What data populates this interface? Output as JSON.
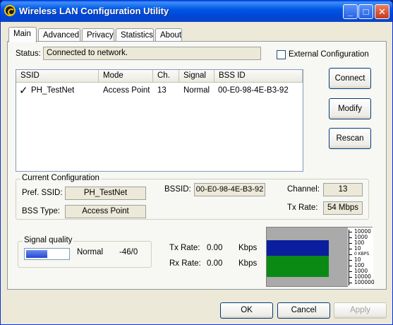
{
  "window": {
    "title": "Wireless LAN Configuration Utility",
    "min_glyph": "_",
    "max_glyph": "□",
    "close_glyph": "✕"
  },
  "tabs": [
    "Main",
    "Advanced",
    "Privacy",
    "Statistics",
    "About"
  ],
  "status": {
    "label": "Status:",
    "value": "Connected to network.",
    "external_config_label": "External Configuration",
    "external_config_checked": false
  },
  "network_list": {
    "columns": [
      "SSID",
      "Mode",
      "Ch.",
      "Signal",
      "BSS ID"
    ],
    "rows": [
      {
        "check": "✓",
        "ssid": "PH_TestNet",
        "mode": "Access Point",
        "channel": "13",
        "signal": "Normal",
        "bssid": "00-E0-98-4E-B3-92"
      }
    ]
  },
  "side_buttons": {
    "connect": "Connect",
    "modify": "Modify",
    "rescan": "Rescan"
  },
  "current_config": {
    "title": "Current Configuration",
    "pref_ssid_label": "Pref. SSID:",
    "pref_ssid": "PH_TestNet",
    "bss_type_label": "BSS Type:",
    "bss_type": "Access Point",
    "bssid_label": "BSSID:",
    "bssid": "00-E0-98-4E-B3-92",
    "channel_label": "Channel:",
    "channel": "13",
    "tx_rate_label": "Tx Rate:",
    "tx_rate": "54 Mbps"
  },
  "signal_quality": {
    "title": "Signal quality",
    "level": "Normal",
    "value": "-46/0",
    "meter_fraction": 0.5
  },
  "rates": {
    "tx_label": "Tx Rate:",
    "tx_value": "0.00",
    "rx_label": "Rx Rate:",
    "rx_value": "0.00",
    "unit": "Kbps"
  },
  "graph": {
    "scale_labels_top": [
      "10000",
      "1000",
      "100",
      "10"
    ],
    "mid_label": "0 KBPS",
    "scale_labels_bottom": [
      "10",
      "100",
      "1000",
      "10000",
      "100000"
    ],
    "tx_color": "#0b1ea0",
    "rx_color": "#0a8a14"
  },
  "dialog_buttons": {
    "ok": "OK",
    "cancel": "Cancel",
    "apply": "Apply"
  }
}
